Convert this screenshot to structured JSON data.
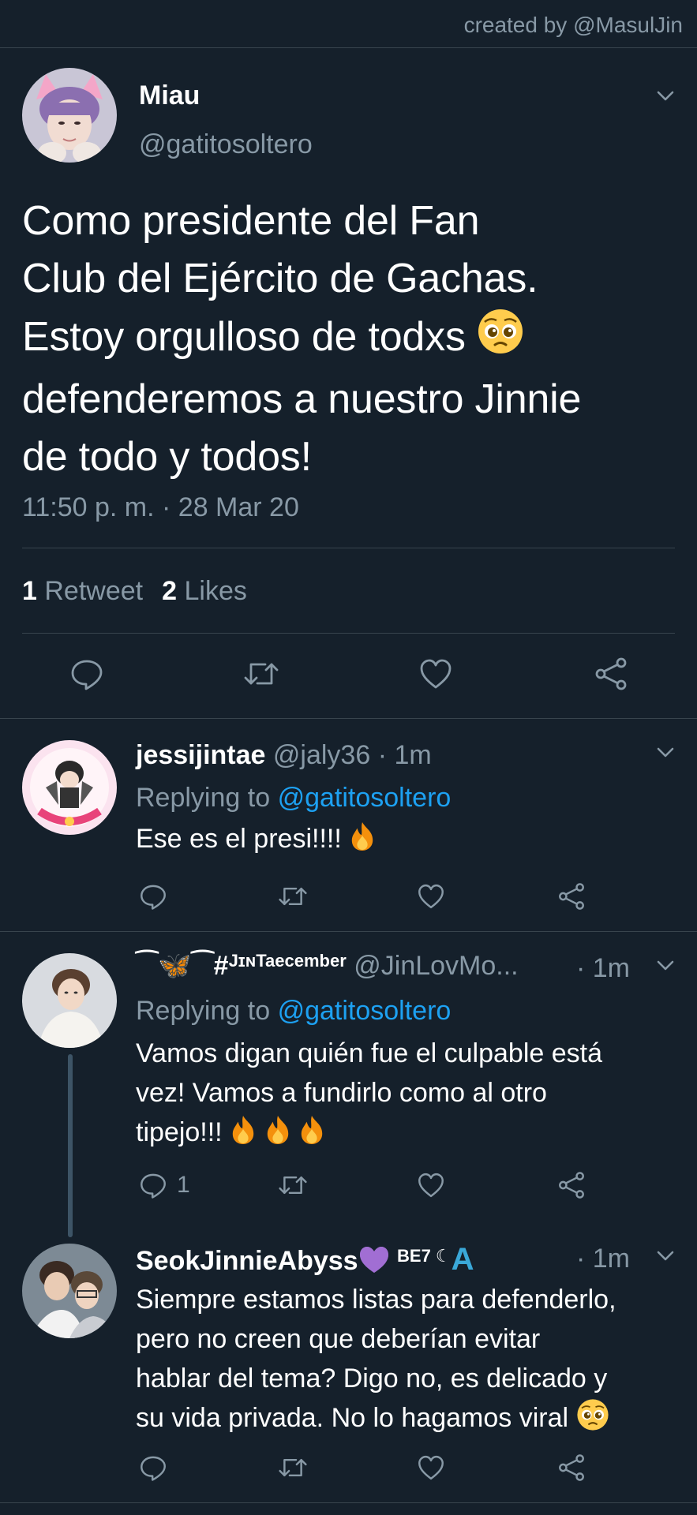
{
  "credit": "created by @MasulJin",
  "tweet": {
    "name": "Miau",
    "handle": "@gatitosoltero",
    "text_lines": [
      "Como presidente del Fan",
      "Club del Ejército de Gachas.",
      "Estoy orgulloso de todxs",
      "defenderemos a nuestro Jinnie",
      "de todo y todos!"
    ],
    "timestamp": "11:50 p. m. · 28 Mar 20",
    "retweet_count": "1",
    "retweet_label": "Retweet",
    "like_count": "2",
    "like_label": "Likes"
  },
  "replies": [
    {
      "name": "jessijintae",
      "handle": "@jaly36",
      "time": "· 1m",
      "replying_prefix": "Replying to",
      "mention": "@gatitosoltero",
      "text_lines": [
        "Ese es el presi!!!!"
      ],
      "reply_count": ""
    },
    {
      "name_decor": "⁀🦋⁀#",
      "name_small": "JɪɴTaecember",
      "handle": "@JinLovMo...",
      "time": "· 1m",
      "replying_prefix": "Replying to",
      "mention": "@gatitosoltero",
      "text_lines": [
        "Vamos digan quién fue el culpable está",
        "vez! Vamos a fundirlo como al otro",
        "tipejo!!!"
      ],
      "reply_count": "1"
    },
    {
      "name": "SeokJinnieAbyss",
      "name_suffix": "BE7 ☾",
      "name_badge": "A",
      "time": "· 1m",
      "text_lines": [
        "Siempre estamos listas para defenderlo,",
        "pero no creen que deberían evitar",
        "hablar del tema? Digo no, es delicado y",
        "su vida privada. No lo hagamos viral"
      ],
      "reply_count": ""
    }
  ],
  "icons": {
    "reply": "reply-icon",
    "retweet": "retweet-icon",
    "like": "heart-icon",
    "share": "share-icon",
    "more": "chevron-down-icon"
  },
  "colors": {
    "background": "#15202b",
    "secondary_text": "#8899a6",
    "divider": "#38444d",
    "mention": "#1da1f2"
  }
}
